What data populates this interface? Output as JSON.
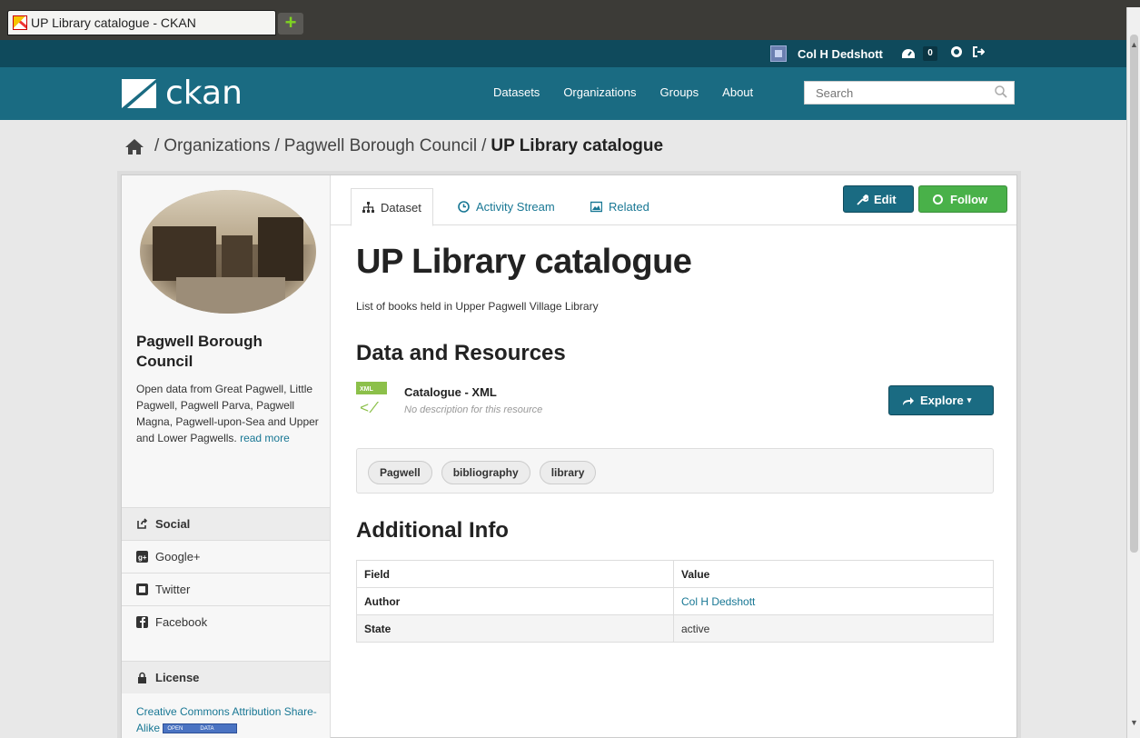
{
  "browser": {
    "tab_title": "UP Library catalogue - CKAN",
    "new_tab_symbol": "+"
  },
  "account": {
    "user_name": "Col H Dedshott",
    "dashboard_count": "0"
  },
  "nav": {
    "logo_text": "ckan",
    "links": [
      "Datasets",
      "Organizations",
      "Groups",
      "About"
    ],
    "search_placeholder": "Search"
  },
  "breadcrumb": {
    "items": [
      "Organizations",
      "Pagwell Borough Council"
    ],
    "current": "UP Library catalogue"
  },
  "organization": {
    "title": "Pagwell Borough Council",
    "description": "Open data from Great Pagwell, Little Pagwell, Pagwell Parva, Pagwell Magna, Pagwell-upon-Sea and Upper and Lower Pagwells.",
    "read_more": "read more"
  },
  "social": {
    "header": "Social",
    "items": [
      "Google+",
      "Twitter",
      "Facebook"
    ]
  },
  "license": {
    "header": "License",
    "name": "Creative Commons Attribution Share-Alike",
    "badge_left": "OPEN",
    "badge_right": "DATA"
  },
  "tabs": [
    "Dataset",
    "Activity Stream",
    "Related"
  ],
  "actions": {
    "edit": "Edit",
    "follow": "Follow",
    "explore": "Explore"
  },
  "dataset": {
    "title": "UP Library catalogue",
    "notes": "List of books held in Upper Pagwell Village Library"
  },
  "resources": {
    "heading": "Data and Resources",
    "items": [
      {
        "icon_label": "XML",
        "title": "Catalogue - XML",
        "description": "No description for this resource"
      }
    ]
  },
  "tags": [
    "Pagwell",
    "bibliography",
    "library"
  ],
  "additional_info": {
    "heading": "Additional Info",
    "columns": [
      "Field",
      "Value"
    ],
    "rows": [
      {
        "field": "Author",
        "value": "Col H Dedshott"
      },
      {
        "field": "State",
        "value": "active"
      }
    ]
  },
  "colors": {
    "masthead_dark": "#0f4a5c",
    "masthead": "#1a6b82",
    "link": "#187794",
    "follow_green": "#49b149"
  }
}
